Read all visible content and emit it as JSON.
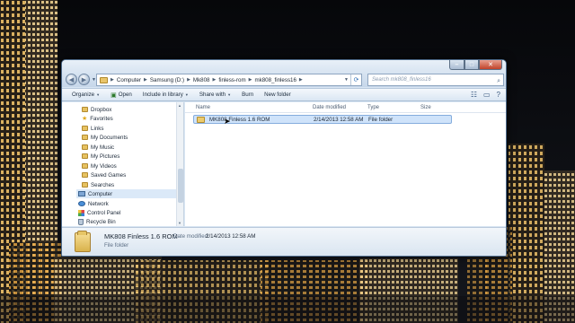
{
  "window": {
    "address": {
      "segments": [
        "Computer",
        "Samsung (D:)",
        "Mk808",
        "finless-rom",
        "mk808_finless16"
      ]
    },
    "search": {
      "placeholder": "Search mk808_finless16"
    }
  },
  "commandbar": {
    "organize": "Organize",
    "open": "Open",
    "include": "Include in library",
    "share": "Share with",
    "burn": "Burn",
    "new_folder": "New folder"
  },
  "navpane": {
    "items": [
      {
        "label": "Dropbox",
        "icon": "folder-icon"
      },
      {
        "label": "Favorites",
        "icon": "star-icon"
      },
      {
        "label": "Links",
        "icon": "folder-icon"
      },
      {
        "label": "My Documents",
        "icon": "folder-icon"
      },
      {
        "label": "My Music",
        "icon": "folder-icon"
      },
      {
        "label": "My Pictures",
        "icon": "folder-icon"
      },
      {
        "label": "My Videos",
        "icon": "folder-icon"
      },
      {
        "label": "Saved Games",
        "icon": "folder-icon"
      },
      {
        "label": "Searches",
        "icon": "folder-icon"
      },
      {
        "label": "Computer",
        "icon": "computer-icon"
      },
      {
        "label": "Network",
        "icon": "network-icon"
      },
      {
        "label": "Control Panel",
        "icon": "control-panel-icon"
      },
      {
        "label": "Recycle Bin",
        "icon": "recycle-bin-icon"
      }
    ]
  },
  "content": {
    "columns": {
      "name": "Name",
      "date": "Date modified",
      "type": "Type",
      "size": "Size"
    },
    "rows": [
      {
        "name": "MK808 Finless 1.6 ROM",
        "date": "2/14/2013 12:58 AM",
        "type": "File folder",
        "size": ""
      }
    ]
  },
  "details": {
    "name": "MK808 Finless 1.6 ROM",
    "modified_label": "Date modified:",
    "modified_value": "2/14/2013 12:58 AM",
    "type": "File folder"
  },
  "colors": {
    "selection": "#cfe3fa",
    "window_frame": "#d9e6f3",
    "folder": "#eccb6e"
  }
}
